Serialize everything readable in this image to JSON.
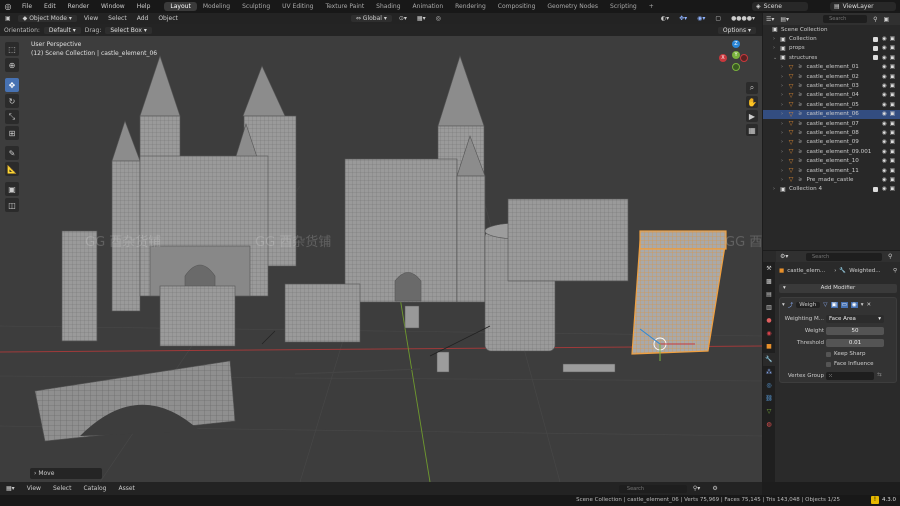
{
  "top_menu": {
    "items": [
      "File",
      "Edit",
      "Render",
      "Window",
      "Help"
    ],
    "workspaces": [
      "Layout",
      "Modeling",
      "Sculpting",
      "UV Editing",
      "Texture Paint",
      "Shading",
      "Animation",
      "Rendering",
      "Compositing",
      "Geometry Nodes",
      "Scripting"
    ],
    "active_workspace": "Layout",
    "add_tab": "+",
    "scene": "Scene",
    "view_layer": "ViewLayer"
  },
  "viewport_header": {
    "mode": "Object Mode",
    "menus": [
      "View",
      "Select",
      "Add",
      "Object"
    ],
    "transform_orientation": "Global"
  },
  "tool_header": {
    "orientation_label": "Orientation:",
    "orientation_value": "Default",
    "drag_label": "Drag:",
    "drag_value": "Select Box",
    "options": "Options"
  },
  "viewport": {
    "view_name": "User Perspective",
    "collection_path": "(12) Scene Collection | castle_element_06",
    "last_operator": "Move",
    "watermark": "GG 酉杂货铺",
    "gizmo_axes": [
      "X",
      "Y",
      "Z"
    ]
  },
  "outliner": {
    "search_placeholder": "Search",
    "rows": [
      {
        "label": "Scene Collection",
        "type": "scene",
        "indent": 0
      },
      {
        "label": "Collection",
        "type": "collection",
        "indent": 1
      },
      {
        "label": "props",
        "type": "collection",
        "indent": 1
      },
      {
        "label": "structures",
        "type": "collection",
        "indent": 1
      },
      {
        "label": "castle_element_01",
        "type": "object",
        "indent": 2
      },
      {
        "label": "castle_element_02",
        "type": "object",
        "indent": 2
      },
      {
        "label": "castle_element_03",
        "type": "object",
        "indent": 2
      },
      {
        "label": "castle_element_04",
        "type": "object",
        "indent": 2
      },
      {
        "label": "castle_element_05",
        "type": "object",
        "indent": 2
      },
      {
        "label": "castle_element_06",
        "type": "object",
        "indent": 2,
        "selected": true
      },
      {
        "label": "castle_element_07",
        "type": "object",
        "indent": 2
      },
      {
        "label": "castle_element_08",
        "type": "object",
        "indent": 2
      },
      {
        "label": "castle_element_09",
        "type": "object",
        "indent": 2
      },
      {
        "label": "castle_element_09.001",
        "type": "object",
        "indent": 2
      },
      {
        "label": "castle_element_10",
        "type": "object",
        "indent": 2
      },
      {
        "label": "castle_element_11",
        "type": "object",
        "indent": 2
      },
      {
        "label": "Pre_made_castle",
        "type": "object",
        "indent": 2
      },
      {
        "label": "Collection 4",
        "type": "collection",
        "indent": 1
      }
    ]
  },
  "properties": {
    "search_placeholder": "Search",
    "object_name": "castle_elem...",
    "modifier_name_short": "Weighted...",
    "add_modifier": "Add Modifier",
    "modifier_label": "Weigh",
    "fields": {
      "weighting_mode_label": "Weighting M...",
      "weighting_mode_value": "Face Area",
      "weight_label": "Weight",
      "weight_value": "50",
      "threshold_label": "Threshold",
      "threshold_value": "0.01",
      "keep_sharp": "Keep Sharp",
      "face_influence": "Face Influence",
      "vertex_group_label": "Vertex Group"
    }
  },
  "asset_bar": {
    "items": [
      "View",
      "Select",
      "Catalog",
      "Asset"
    ],
    "search_placeholder": "Search"
  },
  "status_bar": {
    "stats": "Scene Collection | castle_element_06 | Verts 75,969 | Faces 75,145 | Tris 143,048 | Objects 1/25",
    "version": "4.3.0"
  },
  "colors": {
    "accent": "#4772b3",
    "selection": "#e8902a",
    "x_axis": "#c8383d",
    "y_axis": "#7ab23c",
    "z_axis": "#2b87d8"
  }
}
